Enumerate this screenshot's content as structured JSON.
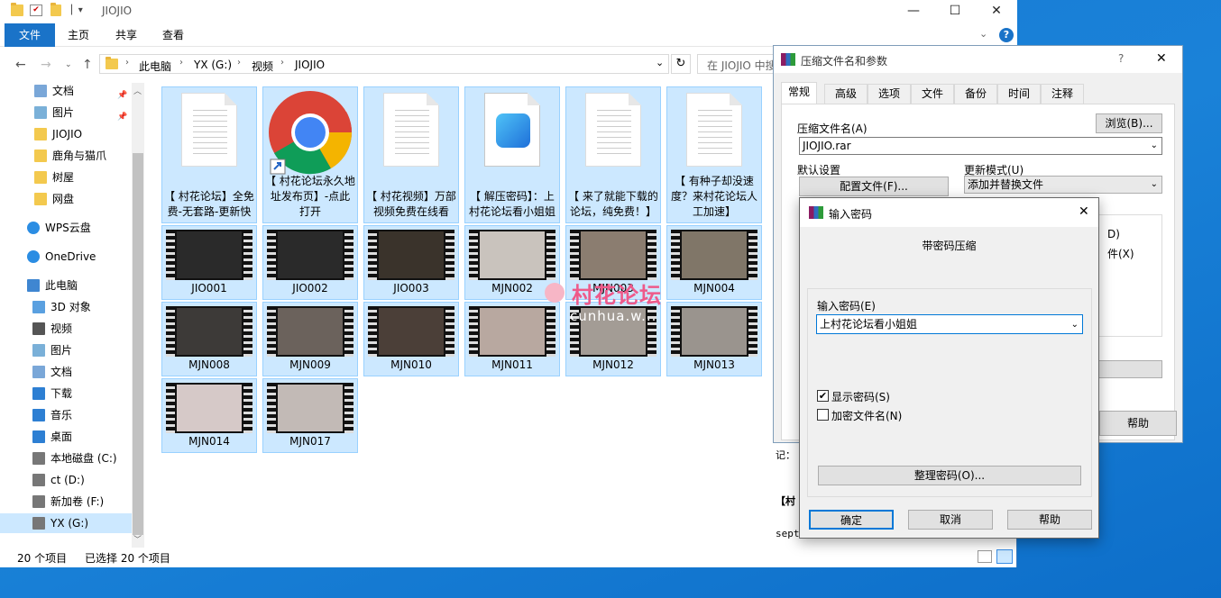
{
  "explorer": {
    "title": "JIOJIO",
    "ribbon_tabs": [
      "文件",
      "主页",
      "共享",
      "查看"
    ],
    "breadcrumb": [
      "此电脑",
      "YX (G:)",
      "视频",
      "JIOJIO"
    ],
    "search_placeholder": "在 JIOJIO 中搜索",
    "sidebar": [
      {
        "label": "文档",
        "icon": "documents-icon",
        "pinned": true
      },
      {
        "label": "图片",
        "icon": "pictures-icon",
        "pinned": true
      },
      {
        "label": "JIOJIO",
        "icon": "folder-icon"
      },
      {
        "label": "鹿角与猫爪",
        "icon": "folder-icon"
      },
      {
        "label": "树屋",
        "icon": "folder-icon"
      },
      {
        "label": "网盘",
        "icon": "folder-icon"
      },
      {
        "label": "WPS云盘",
        "icon": "cloud-icon"
      },
      {
        "label": "OneDrive",
        "icon": "cloud-icon"
      },
      {
        "label": "此电脑",
        "icon": "computer-icon"
      },
      {
        "label": "3D 对象",
        "icon": "3d-objects-icon"
      },
      {
        "label": "视频",
        "icon": "videos-icon"
      },
      {
        "label": "图片",
        "icon": "pictures-icon"
      },
      {
        "label": "文档",
        "icon": "documents-icon"
      },
      {
        "label": "下载",
        "icon": "download-icon"
      },
      {
        "label": "音乐",
        "icon": "music-icon"
      },
      {
        "label": "桌面",
        "icon": "desktop-icon"
      },
      {
        "label": "本地磁盘 (C:)",
        "icon": "drive-icon"
      },
      {
        "label": "ct (D:)",
        "icon": "drive-icon"
      },
      {
        "label": "新加卷 (F:)",
        "icon": "drive-icon"
      },
      {
        "label": "YX (G:)",
        "icon": "drive-icon"
      }
    ],
    "files": [
      {
        "name": "【 村花论坛】全免费-无套路-更新快",
        "kind": "text"
      },
      {
        "name": "【 村花论坛永久地址发布页】-点此打开",
        "kind": "chrome"
      },
      {
        "name": "【 村花视频】万部视频免费在线看",
        "kind": "text"
      },
      {
        "name": "【 解压密码】：上村花论坛看小姐姐",
        "kind": "image"
      },
      {
        "name": "【 来了就能下载的论坛，纯免费！】",
        "kind": "text"
      },
      {
        "name": "【 有种子却没速度？来村花论坛人工加速】",
        "kind": "text"
      },
      {
        "name": "JIO001",
        "kind": "video"
      },
      {
        "name": "JIO002",
        "kind": "video"
      },
      {
        "name": "JIO003",
        "kind": "video"
      },
      {
        "name": "MJN002",
        "kind": "video"
      },
      {
        "name": "MJN003",
        "kind": "video"
      },
      {
        "name": "MJN004",
        "kind": "video"
      },
      {
        "name": "MJN008",
        "kind": "video"
      },
      {
        "name": "MJN009",
        "kind": "video"
      },
      {
        "name": "MJN010",
        "kind": "video"
      },
      {
        "name": "MJN011",
        "kind": "video"
      },
      {
        "name": "MJN012",
        "kind": "video"
      },
      {
        "name": "MJN013",
        "kind": "video"
      },
      {
        "name": "MJN014",
        "kind": "video"
      },
      {
        "name": "MJN017",
        "kind": "video"
      }
    ],
    "status_count": "20 个项目",
    "status_selected": "已选择 20 个项目"
  },
  "rar": {
    "title": "压缩文件名和参数",
    "title_help": "?",
    "tabs": [
      "常规",
      "高级",
      "选项",
      "文件",
      "备份",
      "时间",
      "注释"
    ],
    "archive_name_label": "压缩文件名(A)",
    "archive_name": "JIOJIO.rar",
    "browse_button": "浏览(B)...",
    "default_settings_label": "默认设置",
    "profiles_button": "配置文件(F)...",
    "update_mode_label": "更新模式(U)",
    "update_mode": "添加并替换文件",
    "partial_1": "D)",
    "partial_2": "件(X)",
    "help_button": "帮助"
  },
  "pwd": {
    "title": "输入密码",
    "heading": "带密码压缩",
    "input_label": "输入密码(E)",
    "password_value": "上村花论坛看小姐姐",
    "show_password": "显示密码(S)",
    "show_password_checked": true,
    "encrypt_names": "加密文件名(N)",
    "encrypt_names_checked": false,
    "organize_button": "整理密码(O)...",
    "ok_button": "确定",
    "cancel_button": "取消",
    "help_button": "帮助"
  },
  "background_text": [
    "记：",
    "【村",
    "sept"
  ],
  "watermark": {
    "text": "村花论坛",
    "sub": "cunhua.w..."
  }
}
